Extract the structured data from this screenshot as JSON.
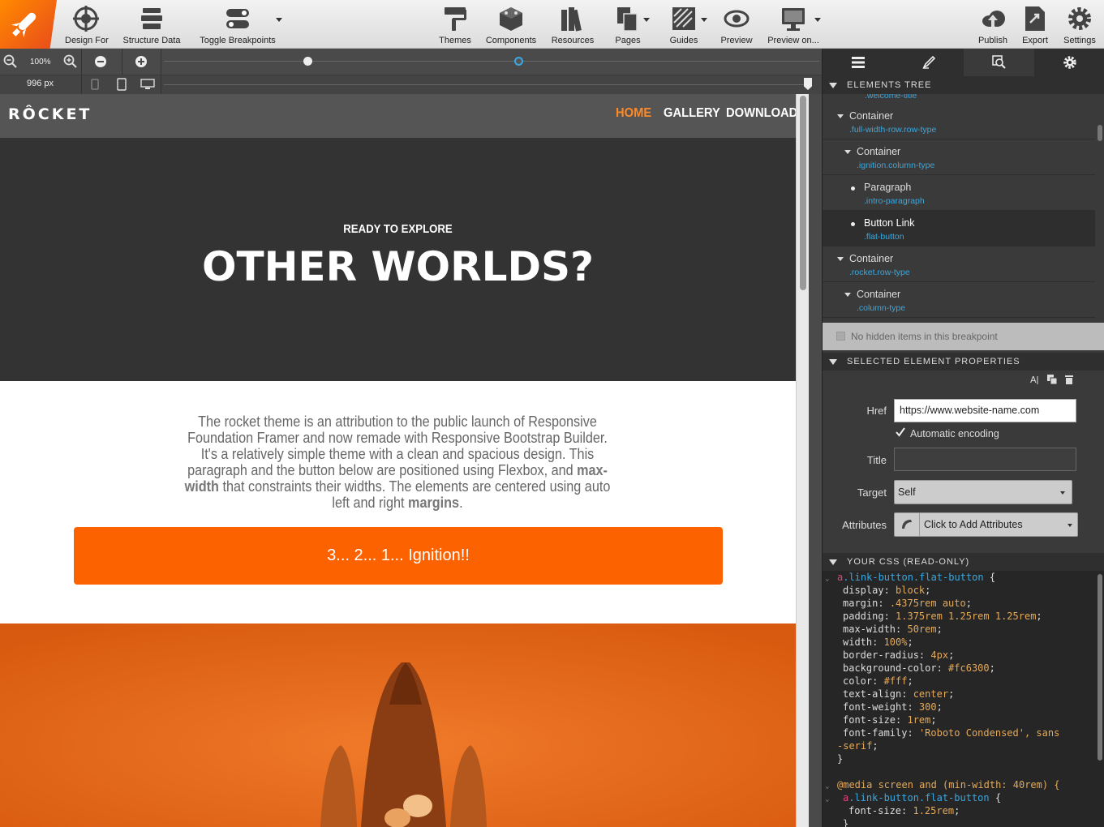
{
  "toolbar": {
    "design_for": "Design For",
    "structure_data": "Structure Data",
    "toggle_breakpoints": "Toggle Breakpoints",
    "themes": "Themes",
    "components": "Components",
    "resources": "Resources",
    "pages": "Pages",
    "guides": "Guides",
    "preview": "Preview",
    "preview_on": "Preview on...",
    "publish": "Publish",
    "export": "Export",
    "settings": "Settings"
  },
  "zoom": {
    "level": "100%",
    "width_px": "996 px"
  },
  "site": {
    "brand": "RÔCKET",
    "nav": [
      "HOME",
      "GALLERY",
      "DOWNLOAD"
    ],
    "kicker": "READY TO EXPLORE",
    "title": "OTHER WORLDS?",
    "intro_1": "The rocket theme is an attribution to the public launch of Responsive Foundation Framer and now remade with Responsive Bootstrap Builder. It's a relatively simple theme with a clean and spacious design. This paragraph and the button below are positioned using Flexbox, and ",
    "intro_b1": "max-width",
    "intro_2": " that constraints their widths. The elements are centered using auto left and right ",
    "intro_b2": "margins",
    "intro_3": ".",
    "button": "3... 2... 1... Ignition!!",
    "accent": "#fc6300"
  },
  "panel": {
    "tree_header": "ELEMENTS TREE",
    "tree_cut": ".welcome-title",
    "tree": [
      {
        "name": "Container",
        "cls": ".full-width-row.row-type",
        "kind": "container"
      },
      {
        "name": "Container",
        "cls": ".ignition.column-type",
        "kind": "container"
      },
      {
        "name": "Paragraph",
        "cls": ".intro-paragraph",
        "kind": "leaf"
      },
      {
        "name": "Button Link",
        "cls": ".flat-button",
        "kind": "leaf"
      },
      {
        "name": "Container",
        "cls": ".rocket.row-type",
        "kind": "container"
      },
      {
        "name": "Container",
        "cls": ".column-type",
        "kind": "container"
      }
    ],
    "hidden_note": "No hidden items in this breakpoint",
    "props_header": "SELECTED ELEMENT PROPERTIES",
    "href_label": "Href",
    "href_value": "https://www.website-name.com",
    "auto_encoding": "Automatic encoding",
    "title_label": "Title",
    "target_label": "Target",
    "target_value": "Self",
    "attributes_label": "Attributes",
    "attributes_value": "Click to Add Attributes",
    "css_header": "YOUR CSS (READ-ONLY)"
  },
  "css": {
    "selector_tag": "a",
    "selector_cls": ".link-button.flat-button",
    "lines": [
      [
        "display",
        "block"
      ],
      [
        "margin",
        ".4375rem auto"
      ],
      [
        "padding",
        "1.375rem 1.25rem 1.25rem"
      ],
      [
        "max-width",
        "50rem"
      ],
      [
        "width",
        "100%"
      ],
      [
        "border-radius",
        "4px"
      ],
      [
        "background-color",
        "#fc6300"
      ],
      [
        "color",
        "#fff"
      ],
      [
        "text-align",
        "center"
      ],
      [
        "font-weight",
        "300"
      ],
      [
        "font-size",
        "1rem"
      ]
    ],
    "font_family_prop": "font-family",
    "font_family_val": "'Roboto Condensed', sans",
    "font_family_cont": "-serif",
    "media": "@media screen and (min-width: 40rem) {",
    "media_size": "1.25rem"
  }
}
